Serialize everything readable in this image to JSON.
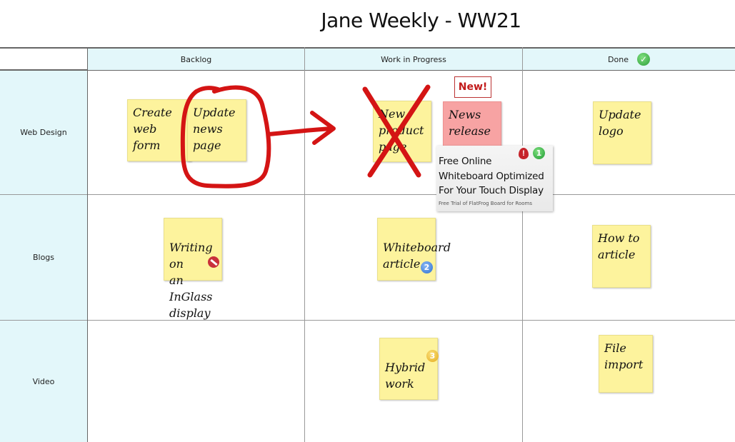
{
  "board": {
    "title": "Jane Weekly - WW21",
    "columns": [
      {
        "label": "Backlog"
      },
      {
        "label": "Work in Progress"
      },
      {
        "label": "Done",
        "icon": "check-circle-icon",
        "icon_color": "#3cb44b"
      }
    ],
    "rows": [
      {
        "label": "Web Design"
      },
      {
        "label": "Blogs"
      },
      {
        "label": "Video"
      }
    ]
  },
  "notes": {
    "create_web_form": {
      "text": "Create\nweb form",
      "color": "#fdf39d"
    },
    "update_news_page": {
      "text": "Update\nnews\npage",
      "color": "#fdf39d"
    },
    "new_product_page": {
      "text": "New\nproduct\npage",
      "color": "#fdf39d"
    },
    "news_release": {
      "text": "News\nrelease",
      "color": "#f7a3a3"
    },
    "update_logo": {
      "text": "Update\nlogo",
      "color": "#fdf39d"
    },
    "writing_inglass": {
      "text": "Writing on\nan InGlass\ndisplay",
      "color": "#fdf39d",
      "icon": "no-entry-icon"
    },
    "whiteboard_article": {
      "text": "Whiteboard\narticle",
      "color": "#fdf39d",
      "badge": "2",
      "badge_color": "#3a7fd9"
    },
    "how_to_article": {
      "text": "How to\narticle",
      "color": "#fdf39d"
    },
    "hybrid_work": {
      "text": "Hybrid\nwork",
      "color": "#fdf39d",
      "badge": "3",
      "badge_color": "#e8b92c"
    },
    "file_import": {
      "text": "File\nimport",
      "color": "#fdf39d"
    }
  },
  "new_label": "New!",
  "ad": {
    "title": "Free Online\nWhiteboard Optimized\nFor Your Touch Display",
    "subtitle": "Free Trial of FlatFrog Board for Rooms",
    "alert_icon": "alert-drop-icon",
    "badge": "1",
    "badge_color": "#2eaa3f"
  },
  "annotations": {
    "ink_color": "#d41414"
  }
}
